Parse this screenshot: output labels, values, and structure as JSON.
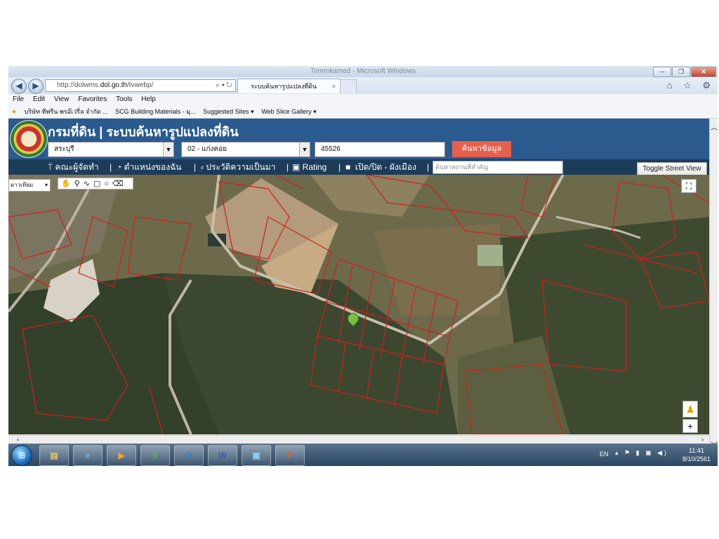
{
  "browser": {
    "window_title": "Tommkamed - Microsoft Windows",
    "url_prefix": "http://dolwms.",
    "url_domain": "dol.go.th",
    "url_path": "/tvwebp/",
    "address_icons": "⌕ ▾ ↻",
    "tab_title": "ระบบค้นหารูปแปลงที่ดิน",
    "tab_close": "×",
    "right_icons": "⌂ ☆ ⚙",
    "menu": [
      "File",
      "Edit",
      "View",
      "Favorites",
      "Tools",
      "Help"
    ],
    "favorites": [
      "บริษัท ทีพรีน พรอ๊เว่รี่ล จำกัด ...",
      "SCG Building Materials - มุ...",
      "Suggested Sites ▾",
      "Web Slice Gallery ▾"
    ]
  },
  "app": {
    "title": "กรมที่ดิน | ระบบค้นหารูปแปลงที่ดิน",
    "province": "สระบุรี",
    "district": "02 - แก่งคอย",
    "parcel_number": "45526",
    "search_button": "ค้นหาข้อมูล",
    "toolbar": {
      "item1": "คณะผู้จัดทำ",
      "item2": "ตำแหน่งของฉัน",
      "item3": "ประวัติความเป็นมา",
      "item4": "Rating",
      "item5": "เปิด/ปิด - ผังเมือง",
      "place_search_placeholder": "ค้นหาสถานที่สำคัญ"
    },
    "toggle_street_view": "Toggle Street View",
    "layer_select": "ดาวเทียม"
  },
  "taskbar": {
    "lang": "EN",
    "time": "11:41",
    "date": "8/10/2561",
    "apps": [
      "explorer",
      "internet-explorer",
      "media-player",
      "excel",
      "outlook",
      "word",
      "photo-viewer",
      "powerpoint"
    ]
  }
}
